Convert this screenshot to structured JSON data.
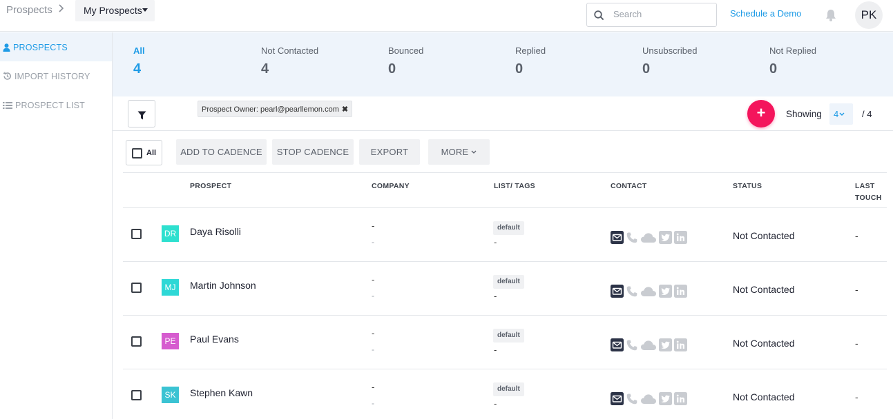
{
  "header": {
    "breadcrumb_root": "Prospects",
    "view_selector": "My Prospects",
    "search_placeholder": "Search",
    "schedule_demo": "Schedule a Demo",
    "user_initials": "PK"
  },
  "sidebar": {
    "items": [
      {
        "label": "PROSPECTS",
        "icon": "user-icon",
        "active": true
      },
      {
        "label": "IMPORT HISTORY",
        "icon": "history-icon",
        "active": false
      },
      {
        "label": "PROSPECT LIST",
        "icon": "list-icon",
        "active": false
      }
    ]
  },
  "summary": {
    "stats": [
      {
        "label": "All",
        "value": "4",
        "active": true
      },
      {
        "label": "Not Contacted",
        "value": "4",
        "active": false
      },
      {
        "label": "Bounced",
        "value": "0",
        "active": false
      },
      {
        "label": "Replied",
        "value": "0",
        "active": false
      },
      {
        "label": "Unsubscribed",
        "value": "0",
        "active": false
      },
      {
        "label": "Not Replied",
        "value": "0",
        "active": false
      }
    ]
  },
  "filters": {
    "chip": "Prospect Owner: pearl@pearllemon.com",
    "chip_close": "✖",
    "add_label": "+",
    "showing_label": "Showing",
    "page_size": "4",
    "total": "/  4"
  },
  "actions": {
    "select_all": "All",
    "add_to_cadence": "ADD TO CADENCE",
    "stop_cadence": "STOP CADENCE",
    "export": "EXPORT",
    "more": "MORE"
  },
  "table": {
    "columns": {
      "prospect": "PROSPECT",
      "company": "COMPANY",
      "tags": "LIST/ TAGS",
      "contact": "CONTACT",
      "status": "STATUS",
      "last_touch_1": "LAST",
      "last_touch_2": "TOUCH"
    },
    "rows": [
      {
        "initials": "DR",
        "color": "#2ee0cf",
        "name": "Daya Risolli",
        "company": "-",
        "company_sub": "-",
        "tag": "default",
        "tag_sub": "-",
        "status": "Not Contacted",
        "last_touch": "-"
      },
      {
        "initials": "MJ",
        "color": "#2ed8d6",
        "name": "Martin Johnson",
        "company": "-",
        "company_sub": "-",
        "tag": "default",
        "tag_sub": "-",
        "status": "Not Contacted",
        "last_touch": "-"
      },
      {
        "initials": "PE",
        "color": "#d65ccf",
        "name": "Paul Evans",
        "company": "-",
        "company_sub": "-",
        "tag": "default",
        "tag_sub": "-",
        "status": "Not Contacted",
        "last_touch": "-"
      },
      {
        "initials": "SK",
        "color": "#3bc3d3",
        "name": "Stephen Kawn",
        "company": "-",
        "company_sub": "-",
        "tag": "default",
        "tag_sub": "-",
        "status": "Not Contacted",
        "last_touch": "-"
      }
    ]
  },
  "colors": {
    "accent": "#1e9be6",
    "add_button": "#f4155c",
    "summary_bg": "#eef4fb"
  }
}
